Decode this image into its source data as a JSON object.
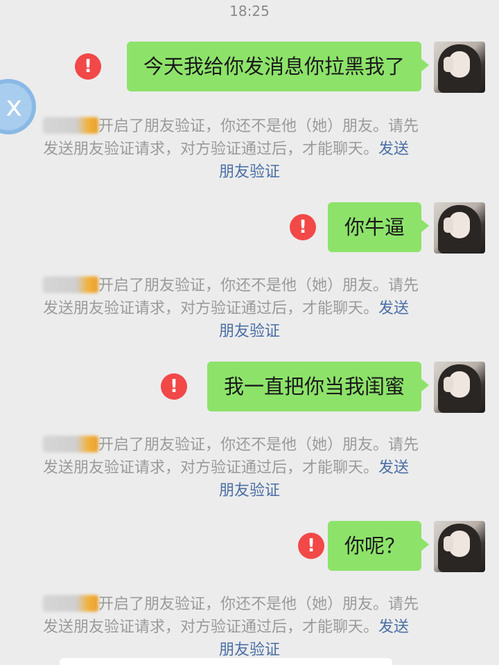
{
  "status_time": "18:25",
  "messages": [
    {
      "text": "今天我给你发消息你拉黑我了",
      "error_icon": "exclamation-icon"
    },
    {
      "text": "你牛逼",
      "error_icon": "exclamation-icon"
    },
    {
      "text": "我一直把你当我闺蜜",
      "error_icon": "exclamation-icon"
    },
    {
      "text": "你呢？",
      "error_icon": "exclamation-icon"
    }
  ],
  "system_notice": {
    "line1": "开启了朋友验证，你还不是他（她）朋友。请先",
    "line2a": "发送朋友验证请求，对方验证通过后，才能聊天。",
    "link_part1": "发送",
    "link_part2": "朋友验证"
  },
  "error_glyph": "!",
  "fab_glyph": "x",
  "colors": {
    "sent_bubble": "#8de36a",
    "error_badge": "#f24848",
    "link": "#4a6fa5",
    "background": "#ececec"
  }
}
